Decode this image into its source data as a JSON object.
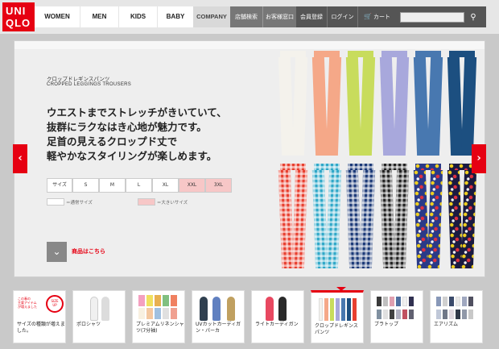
{
  "brand": {
    "logo_line1": "UNI",
    "logo_line2": "QLO",
    "accent": "#e60012"
  },
  "nav": {
    "main": [
      "WOMEN",
      "MEN",
      "KIDS",
      "BABY"
    ],
    "company": "COMPANY",
    "store_links": [
      "店舗検索",
      "お客様窓口"
    ],
    "account_links": [
      "会員登録",
      "ログイン"
    ],
    "cart_label": "カート",
    "search_placeholder": ""
  },
  "hero": {
    "title_jp": "クロップドレギンスパンツ",
    "title_en": "CROPPED LEGGINGS TROUSERS",
    "tagline": [
      "ウエストまでストレッチがきいていて、",
      "抜群にラクなはき心地が魅力です。",
      "足首の見えるクロップド丈で",
      "軽やかなスタイリングが楽しめます。"
    ],
    "size_label": "サイズ",
    "sizes": [
      {
        "label": "S",
        "big": false
      },
      {
        "label": "M",
        "big": false
      },
      {
        "label": "L",
        "big": false
      },
      {
        "label": "XL",
        "big": false
      },
      {
        "label": "XXL",
        "big": true
      },
      {
        "label": "3XL",
        "big": true
      }
    ],
    "legend_normal": "＝通常サイズ",
    "legend_big": "＝大きいサイズ",
    "more_link": "商品はこちら",
    "prev_icon": "chevron-left-icon",
    "next_icon": "chevron-right-icon",
    "pants_top": [
      "#f4f2ec",
      "#f5a888",
      "#c8dc5c",
      "#a8a8dc",
      "#4878b0",
      "#1c4f80"
    ],
    "pants_bottom": [
      {
        "color": "#e84030",
        "pattern": "check"
      },
      {
        "color": "#30a8c8",
        "pattern": "check"
      },
      {
        "color": "#1c3a78",
        "pattern": "check"
      },
      {
        "color": "#222222",
        "pattern": "check"
      },
      {
        "color": "#2a3a88",
        "pattern": "floral"
      },
      {
        "color": "#1a1a40",
        "pattern": "floral"
      }
    ]
  },
  "thumbnails": [
    {
      "caption": "サイズの種類が増えました。",
      "color": "#e60012"
    },
    {
      "caption": "ポロシャツ",
      "color": "#f0f0f0"
    },
    {
      "caption": "プレミアムリネンシャツ(7分袖)",
      "color": "#e8b050"
    },
    {
      "caption": "UVカットカーディガン・パーカ",
      "color": "#6080c0"
    },
    {
      "caption": "ライトカーディガン",
      "color": "#e84860"
    },
    {
      "caption": "クロップドレギンスパンツ",
      "color": "#f5a888"
    },
    {
      "caption": "ブラトップ",
      "color": "#3a3a3a"
    },
    {
      "caption": "エアリズム",
      "color": "#8898b8"
    }
  ]
}
